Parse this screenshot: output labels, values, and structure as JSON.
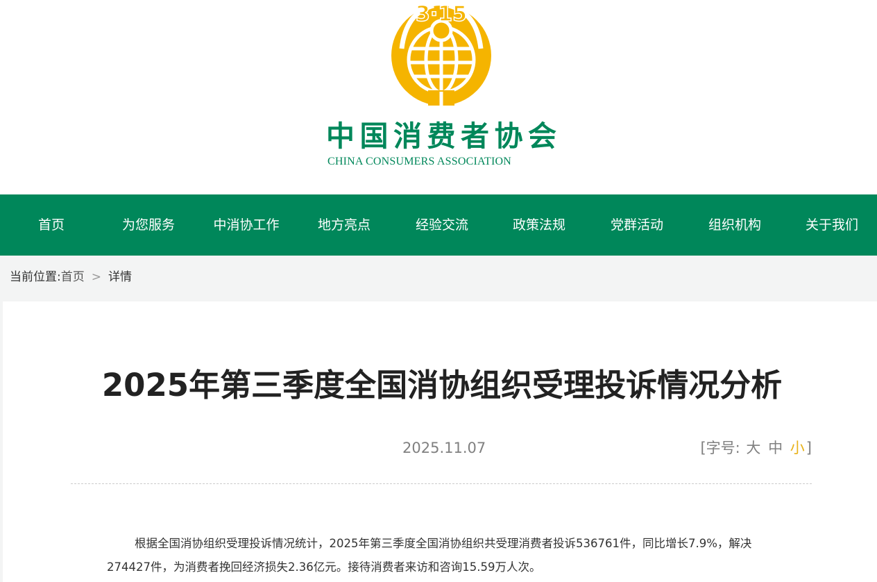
{
  "header": {
    "logo_badge": "3·15",
    "logo_cn": [
      "中",
      "国",
      "消",
      "费",
      "者",
      "协",
      "会"
    ],
    "logo_en": "CHINA CONSUMERS  ASSOCIATION"
  },
  "nav": {
    "items": [
      {
        "label": "首页"
      },
      {
        "label": "为您服务"
      },
      {
        "label": "中消协工作"
      },
      {
        "label": "地方亮点"
      },
      {
        "label": "经验交流"
      },
      {
        "label": "政策法规"
      },
      {
        "label": "党群活动"
      },
      {
        "label": "组织机构"
      },
      {
        "label": "关于我们"
      }
    ]
  },
  "breadcrumb": {
    "prefix": "当前位置:",
    "home": "首页",
    "separator": ">",
    "current": "详情"
  },
  "article": {
    "title": "2025年第三季度全国消协组织受理投诉情况分析",
    "date": "2025.11.07",
    "font_size": {
      "open": "[字号:",
      "large": "大",
      "medium": "中",
      "small": "小",
      "close": "]",
      "active": "small"
    },
    "paragraph": "根据全国消协组织受理投诉情况统计，2025年第三季度全国消协组织共受理消费者投诉536761件，同比增长7.9%，解决274427件，为消费者挽回经济损失2.36亿元。接待消费者来访和咨询15.59万人次。"
  },
  "colors": {
    "brand_green": "#00875a",
    "logo_yellow": "#f5b400",
    "active_font_size": "#e8b21a"
  }
}
